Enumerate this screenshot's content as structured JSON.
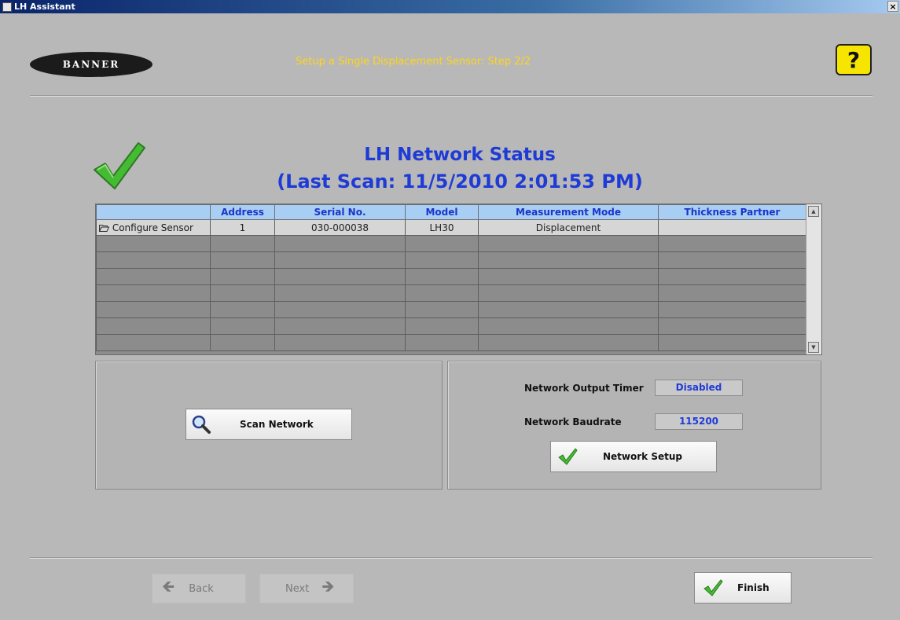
{
  "window": {
    "title": "LH Assistant",
    "close_glyph": "×"
  },
  "header": {
    "logo_text": "BANNER",
    "step_title": "Setup a Single Displacement Sensor: Step 2/2",
    "help_glyph": "?"
  },
  "status": {
    "title_line1": "LH Network Status",
    "title_line2": "(Last Scan: 11/5/2010 2:01:53 PM)"
  },
  "grid": {
    "columns": [
      "",
      "Address",
      "Serial No.",
      "Model",
      "Measurement Mode",
      "Thickness Partner"
    ],
    "rows": [
      {
        "action": "Configure Sensor",
        "address": "1",
        "serial": "030-000038",
        "model": "LH30",
        "mode": "Displacement",
        "partner": ""
      }
    ]
  },
  "scan_panel": {
    "scan_button_label": "Scan Network"
  },
  "network_panel": {
    "output_timer_label": "Network Output Timer",
    "output_timer_value": "Disabled",
    "baudrate_label": "Network Baudrate",
    "baudrate_value": "115200",
    "setup_button_label": "Network Setup"
  },
  "nav": {
    "back_label": "Back",
    "next_label": "Next",
    "finish_label": "Finish"
  },
  "colors": {
    "status_title": "#1f3bd6",
    "step_title": "#ffd41e",
    "configure_cell": "#19e022",
    "header_cell": "#a8cef3",
    "check_green": "#44bb33"
  }
}
